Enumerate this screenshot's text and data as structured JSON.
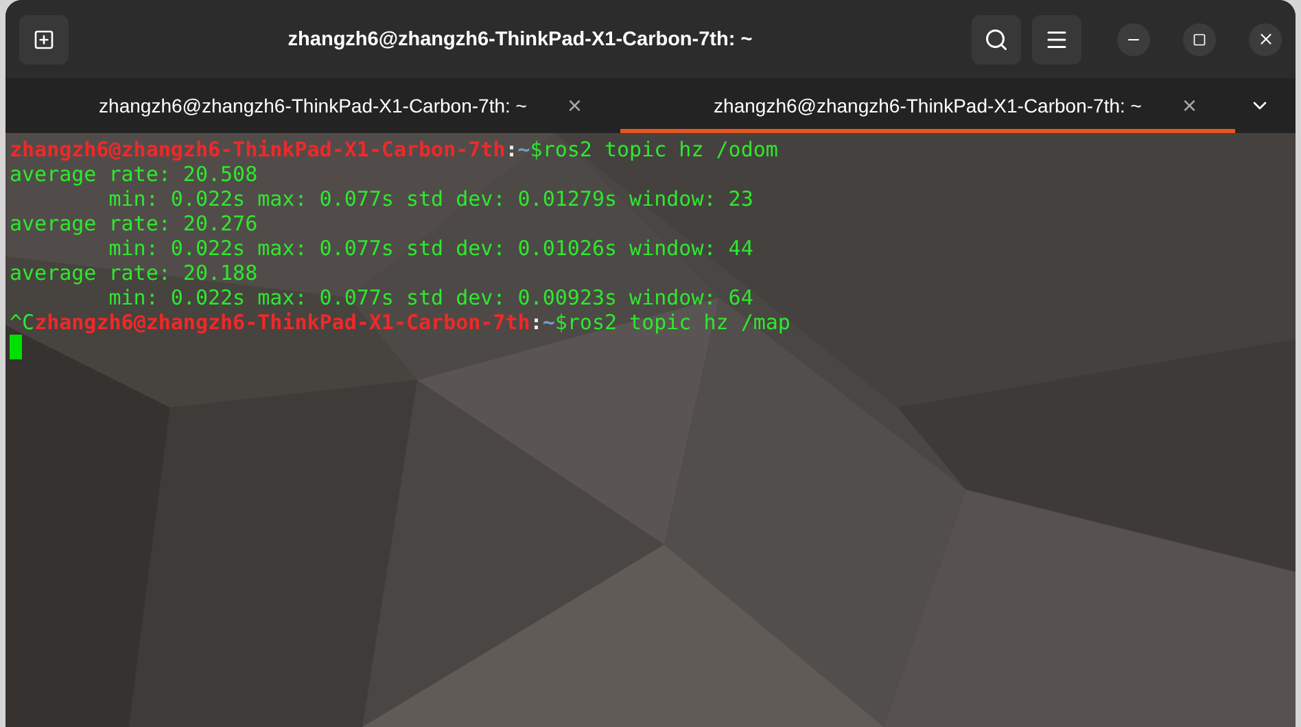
{
  "window": {
    "title": "zhangzh6@zhangzh6-ThinkPad-X1-Carbon-7th: ~"
  },
  "tabs": [
    {
      "label": "zhangzh6@zhangzh6-ThinkPad-X1-Carbon-7th: ~",
      "close": "×",
      "selected": false
    },
    {
      "label": "zhangzh6@zhangzh6-ThinkPad-X1-Carbon-7th: ~",
      "close": "×",
      "selected": true
    }
  ],
  "terminal": {
    "lines": [
      {
        "segments": [
          {
            "kind": "user",
            "text": "zhangzh6@zhangzh6-ThinkPad-X1-Carbon-7th"
          },
          {
            "kind": "sep",
            "text": ":"
          },
          {
            "kind": "path",
            "text": "~"
          },
          {
            "kind": "out",
            "text": "$ros2 topic hz /odom"
          }
        ]
      },
      {
        "segments": [
          {
            "kind": "out",
            "text": "average rate: 20.508"
          }
        ]
      },
      {
        "segments": [
          {
            "kind": "out",
            "text": "        min: 0.022s max: 0.077s std dev: 0.01279s window: 23"
          }
        ]
      },
      {
        "segments": [
          {
            "kind": "out",
            "text": "average rate: 20.276"
          }
        ]
      },
      {
        "segments": [
          {
            "kind": "out",
            "text": "        min: 0.022s max: 0.077s std dev: 0.01026s window: 44"
          }
        ]
      },
      {
        "segments": [
          {
            "kind": "out",
            "text": "average rate: 20.188"
          }
        ]
      },
      {
        "segments": [
          {
            "kind": "out",
            "text": "        min: 0.022s max: 0.077s std dev: 0.00923s window: 64"
          }
        ]
      },
      {
        "segments": [
          {
            "kind": "out",
            "text": "^C"
          },
          {
            "kind": "user",
            "text": "zhangzh6@zhangzh6-ThinkPad-X1-Carbon-7th"
          },
          {
            "kind": "sep",
            "text": ":"
          },
          {
            "kind": "path",
            "text": "~"
          },
          {
            "kind": "out",
            "text": "$ros2 topic hz /map"
          }
        ]
      }
    ]
  }
}
